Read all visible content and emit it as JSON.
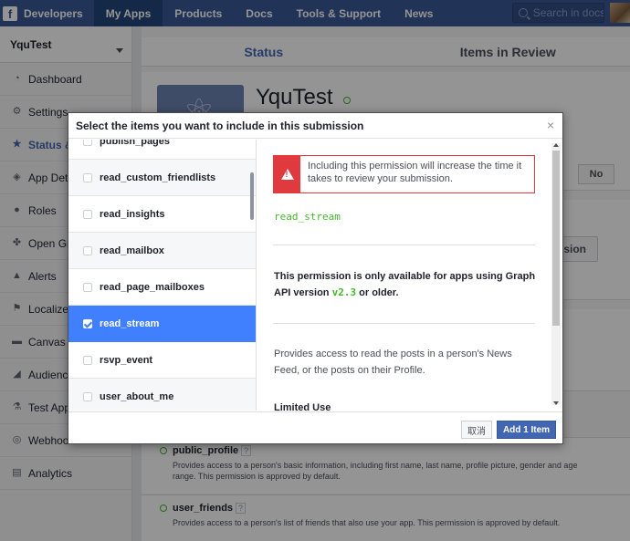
{
  "topnav": {
    "brand": "Developers",
    "items": [
      "My Apps",
      "Products",
      "Docs",
      "Tools & Support",
      "News"
    ],
    "active_index": 0,
    "search_placeholder": "Search in docs"
  },
  "sidebar": {
    "app_name": "YquTest",
    "items": [
      {
        "label": "Dashboard",
        "icon": "dashboard-icon",
        "glyph": "◔"
      },
      {
        "label": "Settings",
        "icon": "gear-icon",
        "glyph": "⚙"
      },
      {
        "label": "Status & Review",
        "icon": "star-icon",
        "glyph": "★"
      },
      {
        "label": "App Details",
        "icon": "cube-icon",
        "glyph": "◈"
      },
      {
        "label": "Roles",
        "icon": "person-icon",
        "glyph": "●"
      },
      {
        "label": "Open Graph",
        "icon": "graph-icon",
        "glyph": "✤"
      },
      {
        "label": "Alerts",
        "icon": "warning-icon",
        "glyph": "▲"
      },
      {
        "label": "Localize",
        "icon": "flag-icon",
        "glyph": "⚑"
      },
      {
        "label": "Canvas Payments",
        "icon": "card-icon",
        "glyph": "▬"
      },
      {
        "label": "Audience Network",
        "icon": "megaphone-icon",
        "glyph": "◢"
      },
      {
        "label": "Test Apps",
        "icon": "flask-icon",
        "glyph": "⚗"
      },
      {
        "label": "Webhooks",
        "icon": "globe-icon",
        "glyph": "◎"
      },
      {
        "label": "Analytics",
        "icon": "chart-icon",
        "glyph": "▤"
      }
    ],
    "active_index": 2
  },
  "main": {
    "tabs": [
      "Status",
      "Items in Review"
    ],
    "active_tab": 0,
    "app_title": "YquTest",
    "no_label": "No",
    "submission_button": "Start a Submission",
    "permissions": [
      {
        "name": "public_profile",
        "help": "?",
        "desc": "Provides access to a person's basic information, including first name, last name, profile picture, gender and age range. This permission is approved by default."
      },
      {
        "name": "user_friends",
        "help": "?",
        "desc": "Provides access to a person's list of friends that also use your app. This permission is approved by default."
      }
    ]
  },
  "dialog": {
    "title": "Select the items you want to include in this submission",
    "close_glyph": "×",
    "items": [
      "publish_pages",
      "read_custom_friendlists",
      "read_insights",
      "read_mailbox",
      "read_page_mailboxes",
      "read_stream",
      "rsvp_event",
      "user_about_me"
    ],
    "selected_index": 5,
    "warning": "Including this permission will increase the time it takes to review your submission.",
    "permission_name": "read_stream",
    "availability_prefix": "This permission is only available for apps using Graph API version ",
    "availability_version": "v2.3",
    "availability_suffix": " or older.",
    "description": "Provides access to read the posts in a person's News Feed, or the posts on their Profile.",
    "limited_use": "Limited Use",
    "cancel_label": "取消",
    "add_label": "Add 1 Item"
  }
}
